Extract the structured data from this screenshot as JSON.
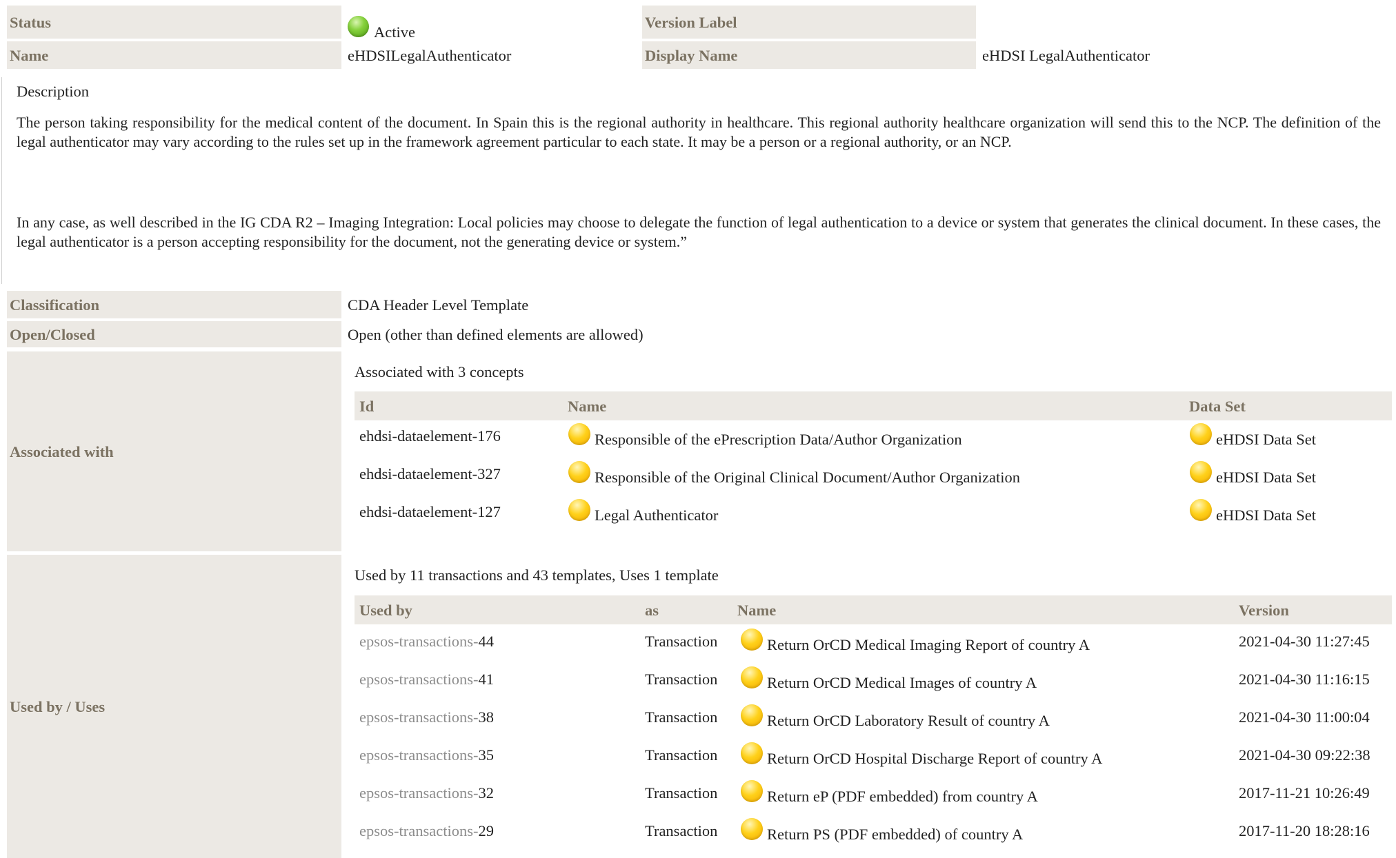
{
  "header": {
    "status_label": "Status",
    "status_value": "Active",
    "version_label_label": "Version Label",
    "version_label_value": "",
    "name_label": "Name",
    "name_value": "eHDSILegalAuthenticator",
    "display_name_label": "Display Name",
    "display_name_value": "eHDSI LegalAuthenticator"
  },
  "description": {
    "heading": "Description",
    "para1": "The person taking responsibility for the medical content of the document. In Spain this is the regional authority in healthcare. This regional authority healthcare organization will send this to the NCP. The definition of the legal authenticator may vary according to the rules set up in the framework agreement particular to each state. It may be a person or a regional authority, or an NCP.",
    "para2": "In any case, as well described in the IG CDA R2 – Imaging Integration: Local policies may choose to delegate the function of legal authentication to a device or system that generates the clinical document. In these cases, the legal authenticator is a person accepting responsibility for the document, not the generating device or system.”"
  },
  "classification": {
    "label": "Classification",
    "value": "CDA Header Level Template"
  },
  "open_closed": {
    "label": "Open/Closed",
    "value": "Open (other than defined elements are allowed)"
  },
  "associated": {
    "label": "Associated with",
    "summary": "Associated with 3 concepts",
    "columns": {
      "id": "Id",
      "name": "Name",
      "dataset": "Data Set"
    },
    "rows": [
      {
        "id": "ehdsi-dataelement-176",
        "name": "Responsible of the ePrescription Data/Author Organization",
        "dataset": "eHDSI Data Set"
      },
      {
        "id": "ehdsi-dataelement-327",
        "name": "Responsible of the Original Clinical Document/Author Organization",
        "dataset": "eHDSI Data Set"
      },
      {
        "id": "ehdsi-dataelement-127",
        "name": "Legal Authenticator",
        "dataset": "eHDSI Data Set"
      }
    ]
  },
  "used_by": {
    "label": "Used by / Uses",
    "summary": "Used by 11 transactions and 43 templates, Uses 1 template",
    "columns": {
      "used_by": "Used by",
      "as": "as",
      "name": "Name",
      "version": "Version"
    },
    "rows": [
      {
        "prefix": "epsos-transactions-",
        "num": "44",
        "as": "Transaction",
        "name": "Return OrCD Medical Imaging Report of country A",
        "version": "2021-04-30 11:27:45"
      },
      {
        "prefix": "epsos-transactions-",
        "num": "41",
        "as": "Transaction",
        "name": "Return OrCD Medical Images of country A",
        "version": "2021-04-30 11:16:15"
      },
      {
        "prefix": "epsos-transactions-",
        "num": "38",
        "as": "Transaction",
        "name": "Return OrCD Laboratory Result of country A",
        "version": "2021-04-30 11:00:04"
      },
      {
        "prefix": "epsos-transactions-",
        "num": "35",
        "as": "Transaction",
        "name": "Return OrCD Hospital Discharge Report of country A",
        "version": "2021-04-30 09:22:38"
      },
      {
        "prefix": "epsos-transactions-",
        "num": "32",
        "as": "Transaction",
        "name": "Return eP (PDF embedded) from country A",
        "version": "2017-11-21 10:26:49"
      },
      {
        "prefix": "epsos-transactions-",
        "num": "29",
        "as": "Transaction",
        "name": "Return PS (PDF embedded) of country A",
        "version": "2017-11-20 18:28:16"
      }
    ]
  }
}
